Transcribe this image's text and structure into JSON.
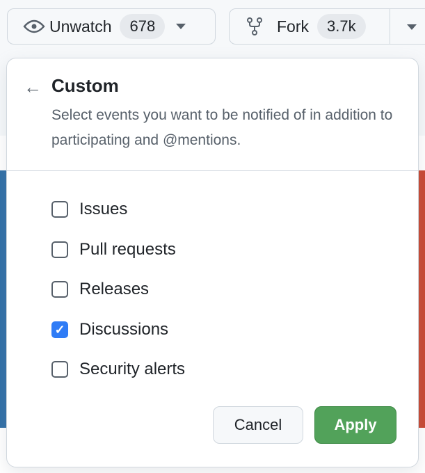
{
  "toolbar": {
    "watch_label": "Unwatch",
    "watch_count": "678",
    "fork_label": "Fork",
    "fork_count": "3.7k"
  },
  "panel": {
    "title": "Custom",
    "description": "Select events you want to be notified of in addition to participating and @mentions.",
    "options": [
      {
        "label": "Issues",
        "checked": false
      },
      {
        "label": "Pull requests",
        "checked": false
      },
      {
        "label": "Releases",
        "checked": false
      },
      {
        "label": "Discussions",
        "checked": true
      },
      {
        "label": "Security alerts",
        "checked": false
      }
    ],
    "cancel_label": "Cancel",
    "apply_label": "Apply"
  },
  "colors": {
    "accent": "#2f7cf6",
    "apply": "#52a25a"
  }
}
